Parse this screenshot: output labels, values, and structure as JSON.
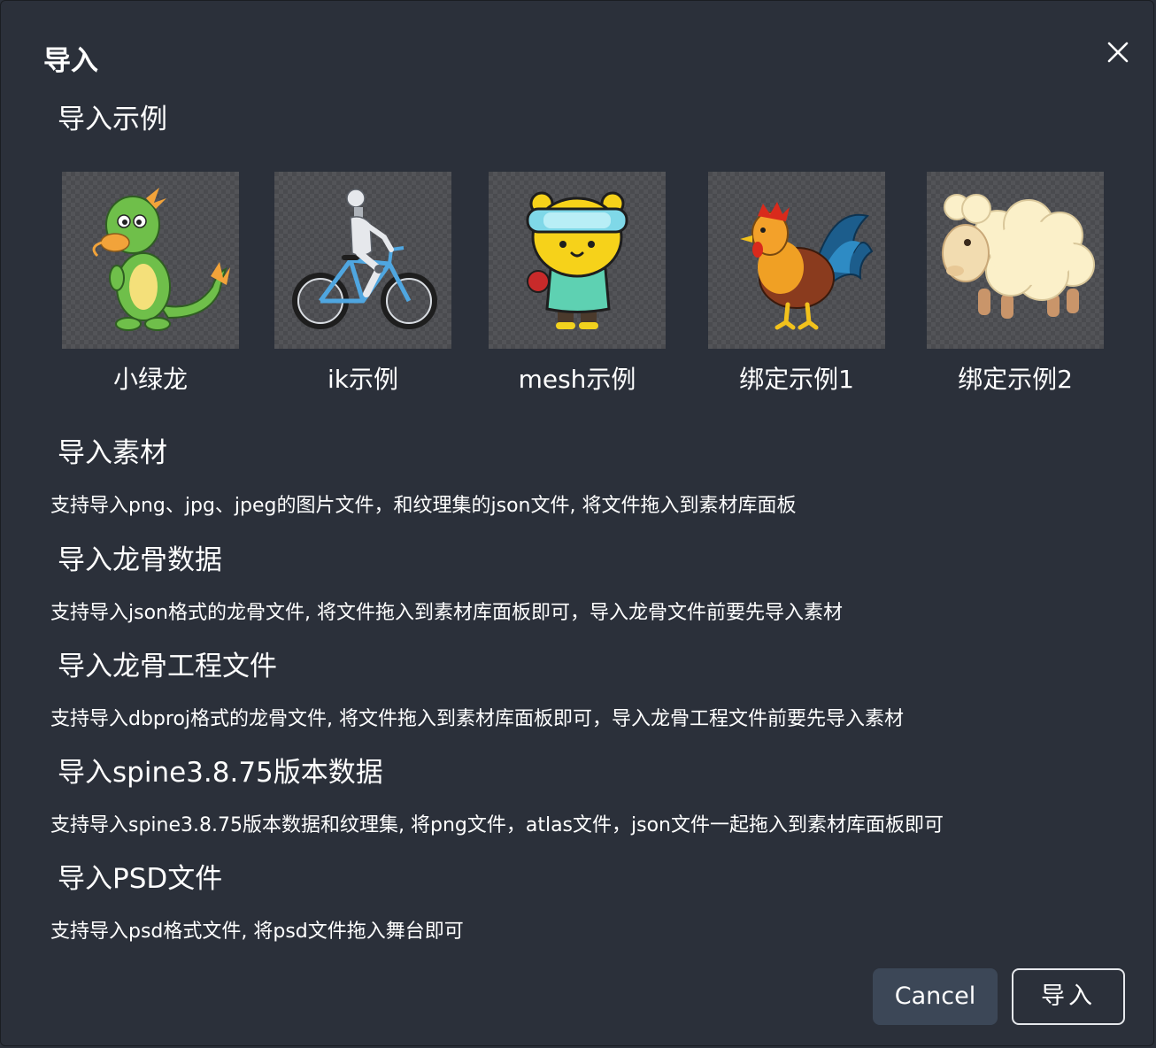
{
  "dialog": {
    "title": "导入",
    "close_icon": "close-icon"
  },
  "examples_section": {
    "title": "导入示例",
    "items": [
      {
        "label": "小绿龙",
        "icon": "green-dragon-thumbnail"
      },
      {
        "label": "ik示例",
        "icon": "robot-bicycle-thumbnail"
      },
      {
        "label": "mesh示例",
        "icon": "yellow-bear-thumbnail"
      },
      {
        "label": "绑定示例1",
        "icon": "rooster-thumbnail"
      },
      {
        "label": "绑定示例2",
        "icon": "sheep-thumbnail"
      }
    ]
  },
  "sections": [
    {
      "title": "导入素材",
      "desc": "支持导入png、jpg、jpeg的图片文件，和纹理集的json文件, 将文件拖入到素材库面板"
    },
    {
      "title": "导入龙骨数据",
      "desc": "支持导入json格式的龙骨文件, 将文件拖入到素材库面板即可，导入龙骨文件前要先导入素材"
    },
    {
      "title": "导入龙骨工程文件",
      "desc": "支持导入dbproj格式的龙骨文件, 将文件拖入到素材库面板即可，导入龙骨工程文件前要先导入素材"
    },
    {
      "title": "导入spine3.8.75版本数据",
      "desc": "支持导入spine3.8.75版本数据和纹理集, 将png文件，atlas文件，json文件一起拖入到素材库面板即可"
    },
    {
      "title": "导入PSD文件",
      "desc": "支持导入psd格式文件, 将psd文件拖入舞台即可"
    }
  ],
  "footer": {
    "cancel_label": "Cancel",
    "import_label": "导入"
  },
  "colors": {
    "background": "#2b303a",
    "cancel_button": "#3c4757",
    "text": "#ffffff"
  }
}
